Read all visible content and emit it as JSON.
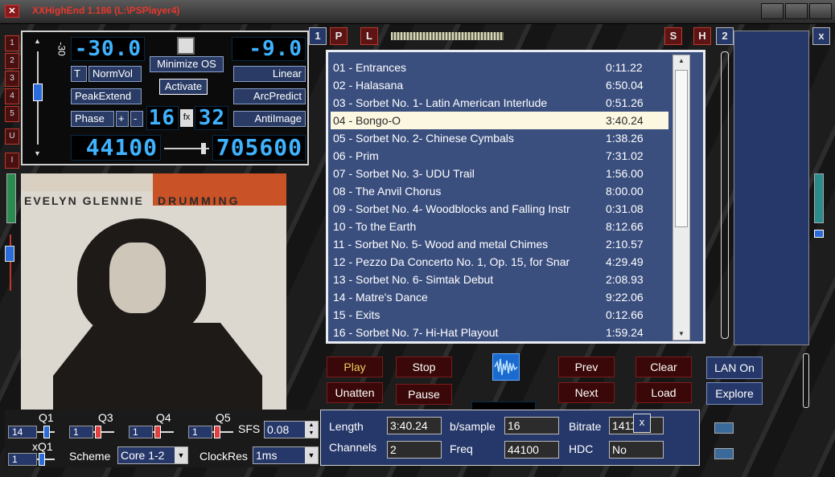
{
  "window": {
    "title": "XXHighEnd 1.186 (L:\\PSPlayer4)"
  },
  "sidebar_left": {
    "buttons": [
      "1",
      "2",
      "3",
      "4",
      "5",
      "U",
      "I"
    ]
  },
  "control": {
    "volume_label": "-30",
    "lcd_volume": "-30.0",
    "lcd_right_top": "-9.0",
    "minimize_label": "Minimize OS",
    "activate_label": "Activate",
    "t_label": "T",
    "normvol_label": "NormVol",
    "linear_label": "Linear",
    "peakextend_label": "PeakExtend",
    "arcpredict_label": "ArcPredict",
    "phase_label": "Phase",
    "plus_label": "+",
    "minus_label": "-",
    "lcd_bits": "16",
    "fx_label": "fx",
    "lcd_bits2": "32",
    "antiimage_label": "AntiImage",
    "lcd_rate_in": "44100",
    "lcd_rate_out": "705600"
  },
  "album": {
    "artist": "EVELYN GLENNIE",
    "title": "DRUMMING"
  },
  "top_buttons": {
    "one": "1",
    "p": "P",
    "l": "L",
    "s": "S",
    "h": "H",
    "two": "2",
    "close": "x"
  },
  "playlist": {
    "tracks": [
      {
        "name": "01 - Entrances",
        "time": "0:11.22"
      },
      {
        "name": "02 - Halasana",
        "time": "6:50.04"
      },
      {
        "name": "03 - Sorbet No. 1- Latin American Interlude",
        "time": "0:51.26"
      },
      {
        "name": "04 - Bongo-O",
        "time": "3:40.24"
      },
      {
        "name": "05 - Sorbet No. 2- Chinese Cymbals",
        "time": "1:38.26"
      },
      {
        "name": "06 - Prim",
        "time": "7:31.02"
      },
      {
        "name": "07 - Sorbet No. 3- UDU Trail",
        "time": "1:56.00"
      },
      {
        "name": "08 - The Anvil Chorus",
        "time": "8:00.00"
      },
      {
        "name": "09 - Sorbet No. 4- Woodblocks and Falling Instr",
        "time": "0:31.08"
      },
      {
        "name": "10 - To the Earth",
        "time": "8:12.66"
      },
      {
        "name": "11 - Sorbet No. 5- Wood and metal Chimes",
        "time": "2:10.57"
      },
      {
        "name": "12 - Pezzo Da Concerto No. 1, Op. 15, for Snar",
        "time": "4:29.49"
      },
      {
        "name": "13 - Sorbet No. 6- Simtak Debut",
        "time": "2:08.93"
      },
      {
        "name": "14 - Matre's Dance",
        "time": "9:22.06"
      },
      {
        "name": "15 - Exits",
        "time": "0:12.66"
      },
      {
        "name": "16 - Sorbet No. 7- Hi-Hat Playout",
        "time": "1:59.24"
      }
    ],
    "selected_index": 3
  },
  "transport": {
    "play": "Play",
    "stop": "Stop",
    "prev": "Prev",
    "clear": "Clear",
    "unatten": "Unatten",
    "pause": "Pause",
    "next": "Next",
    "load": "Load"
  },
  "network": {
    "lan": "LAN On",
    "explore": "Explore"
  },
  "info": {
    "length_label": "Length",
    "length": "3:40.24",
    "bsample_label": "b/sample",
    "bsample": "16",
    "bitrate_label": "Bitrate",
    "bitrate": "1411",
    "channels_label": "Channels",
    "channels": "2",
    "freq_label": "Freq",
    "freq": "44100",
    "hdc_label": "HDC",
    "hdc": "No",
    "close": "x"
  },
  "quality": {
    "q1": "Q1",
    "q1_val": "14",
    "q3": "Q3",
    "q3_val": "1",
    "q4": "Q4",
    "q4_val": "1",
    "q5": "Q5",
    "q5_val": "1",
    "sfs_label": "SFS",
    "sfs_val": "0.08",
    "xq1": "xQ1",
    "xq1_val": "1",
    "scheme_label": "Scheme",
    "scheme_val": "Core 1-2",
    "clockres_label": "ClockRes",
    "clockres_val": "1ms"
  }
}
